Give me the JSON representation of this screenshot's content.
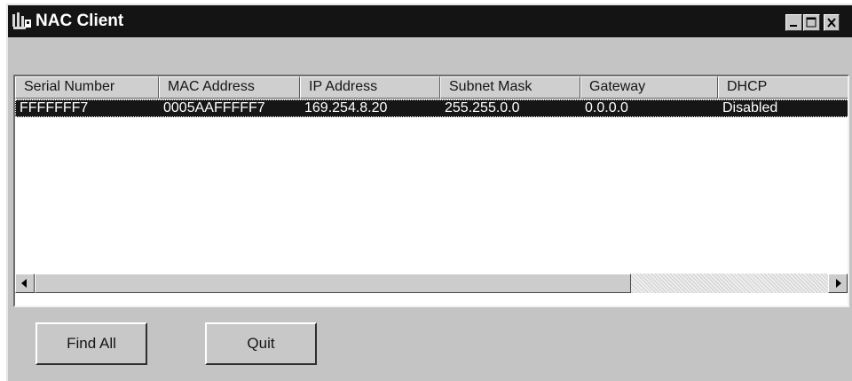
{
  "window": {
    "title": "NAC Client"
  },
  "icons": {
    "app": "network-app-icon",
    "minimize": "minimize-icon",
    "maximize": "maximize-icon",
    "close": "close-icon",
    "scroll_left": "arrow-left-icon",
    "scroll_right": "arrow-right-icon"
  },
  "table": {
    "columns": [
      "Serial Number",
      "MAC Address",
      "IP Address",
      "Subnet Mask",
      "Gateway",
      "DHCP"
    ],
    "rows": [
      {
        "selected": true,
        "cells": [
          "FFFFFFF7",
          "0005AAFFFFF7",
          "169.254.8.20",
          "255.255.0.0",
          "0.0.0.0",
          "Disabled"
        ]
      }
    ]
  },
  "buttons": {
    "find_all": "Find All",
    "quit": "Quit"
  },
  "colors": {
    "title_bar": "#141414",
    "selection": "#161616",
    "face": "#c4c4c4"
  }
}
